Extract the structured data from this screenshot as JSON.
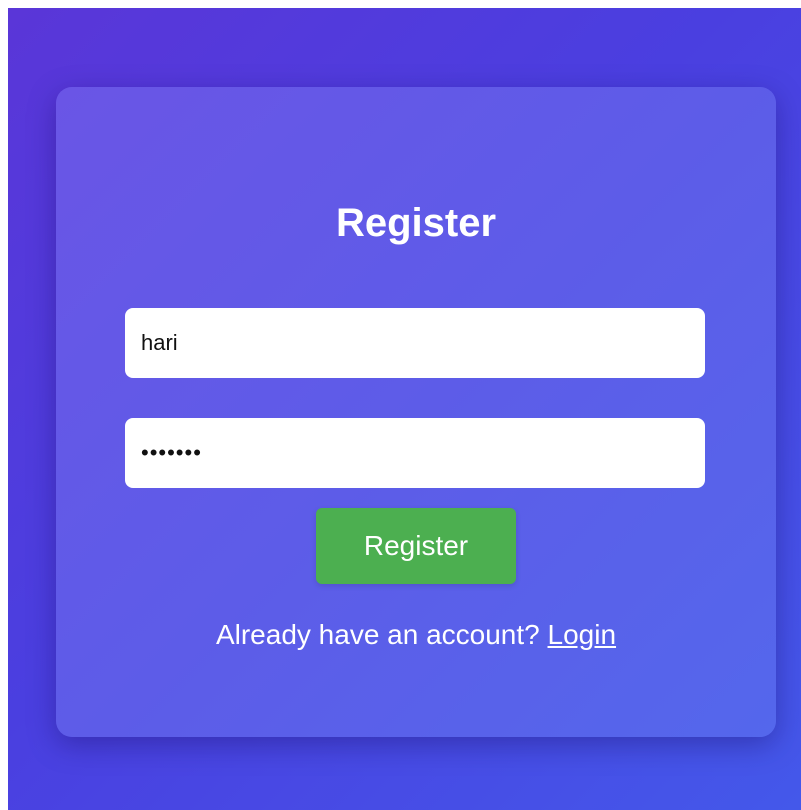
{
  "form": {
    "title": "Register",
    "username_value": "hari",
    "password_value": "•••••••",
    "submit_label": "Register",
    "footer_text": "Already have an account?",
    "login_link": "Login"
  },
  "colors": {
    "background_start": "#5a36d8",
    "background_end": "#4458ea",
    "card": "#5d5ce8",
    "button": "#4caf50",
    "text": "#ffffff"
  }
}
